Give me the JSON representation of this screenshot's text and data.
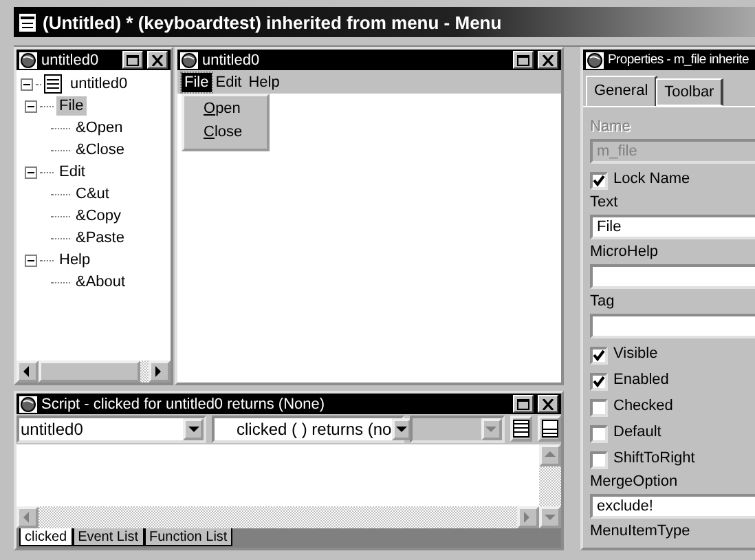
{
  "window": {
    "title": "(Untitled) * (keyboardtest) inherited from menu - Menu"
  },
  "tree_pane": {
    "title": "untitled0",
    "root": {
      "label": "untitled0",
      "expanded": true,
      "selected": false,
      "children": [
        {
          "label": "File",
          "expanded": true,
          "selected": true,
          "children": [
            {
              "label": "&Open",
              "selected": false
            },
            {
              "label": "&Close",
              "selected": false
            }
          ]
        },
        {
          "label": "Edit",
          "expanded": true,
          "selected": false,
          "children": [
            {
              "label": "C&ut",
              "selected": false
            },
            {
              "label": "&Copy",
              "selected": false
            },
            {
              "label": "&Paste",
              "selected": false
            }
          ]
        },
        {
          "label": "Help",
          "expanded": true,
          "selected": false,
          "children": [
            {
              "label": "&About",
              "selected": false
            }
          ]
        }
      ]
    }
  },
  "preview_pane": {
    "title": "untitled0",
    "menu_bar": [
      {
        "label": "File",
        "selected": true
      },
      {
        "label": "Edit",
        "selected": false
      },
      {
        "label": "Help",
        "selected": false
      }
    ],
    "dropdown": [
      "Open",
      "Close"
    ]
  },
  "properties": {
    "title": "Properties - m_file inherite",
    "tabs": [
      {
        "label": "General",
        "selected": true
      },
      {
        "label": "Toolbar",
        "selected": false
      }
    ],
    "fields": [
      {
        "kind": "field",
        "label": "Name",
        "value": "m_file",
        "disabled": true
      },
      {
        "kind": "checkbox",
        "label": "Lock Name",
        "checked": true
      },
      {
        "kind": "field",
        "label": "Text",
        "value": "File",
        "disabled": false
      },
      {
        "kind": "field",
        "label": "MicroHelp",
        "disabled": false
      },
      {
        "kind": "field",
        "label": "Tag",
        "disabled": false
      },
      {
        "kind": "checkbox",
        "label": "Visible",
        "checked": true
      },
      {
        "kind": "checkbox",
        "label": "Enabled",
        "checked": true
      },
      {
        "kind": "checkbox",
        "label": "Checked",
        "checked": false
      },
      {
        "kind": "checkbox",
        "label": "Default",
        "checked": false
      },
      {
        "kind": "checkbox",
        "label": "ShiftToRight",
        "checked": false
      },
      {
        "kind": "field",
        "label": "MergeOption",
        "value": "exclude!",
        "disabled": false
      },
      {
        "kind": "label",
        "label": "MenuItemType"
      }
    ]
  },
  "script_pane": {
    "title": "Script - clicked for untitled0 returns (None)",
    "combos": [
      {
        "value": "untitled0",
        "disabled": false
      },
      {
        "value": "clicked ( ) returns (no",
        "disabled": false
      },
      {
        "disabled": true
      }
    ],
    "tabs": [
      {
        "label": "clicked",
        "selected": true
      },
      {
        "label": "Event List",
        "selected": false
      },
      {
        "label": "Function List",
        "selected": false
      }
    ]
  }
}
